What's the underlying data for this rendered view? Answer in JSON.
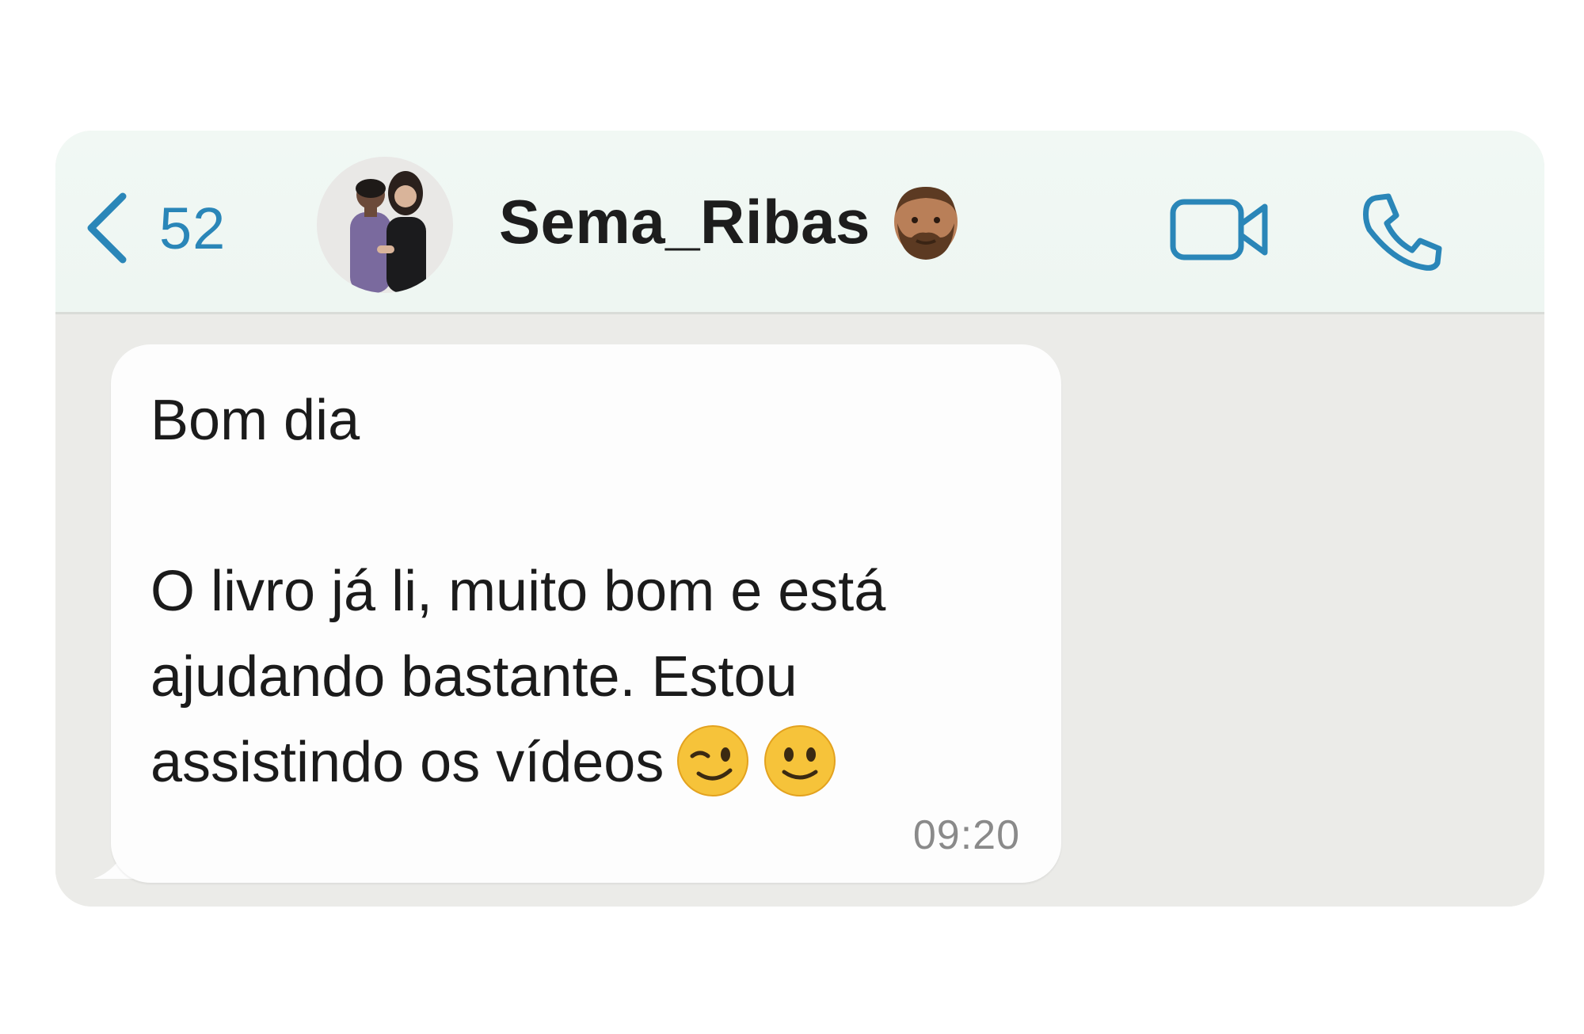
{
  "header": {
    "back_count": "52",
    "contact_name": "Sema_Ribas",
    "contact_emoji": "bearded-man-emoji",
    "back_icon": "chevron-left-icon",
    "video_icon": "video-camera-icon",
    "call_icon": "phone-icon",
    "accent_color": "#2a86b8"
  },
  "message": {
    "line1": "Bom dia",
    "line2": "O livro já li, muito bom e está",
    "line3": "ajudando bastante. Estou",
    "line4": "assistindo os vídeos",
    "emojis": [
      "winking-face-emoji",
      "slightly-smiling-face-emoji"
    ],
    "time": "09:20"
  }
}
